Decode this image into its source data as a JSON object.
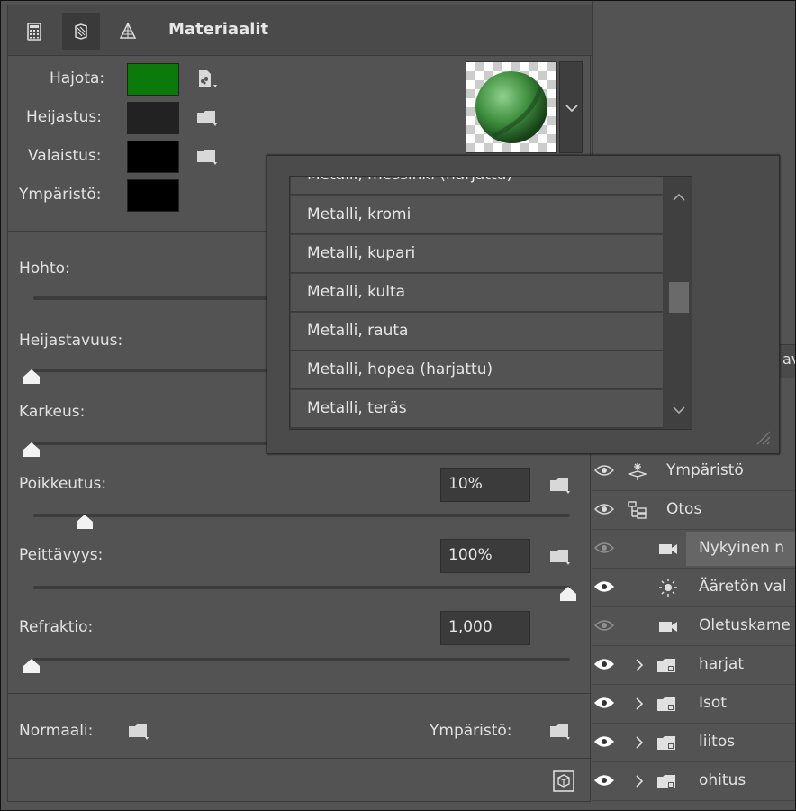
{
  "panel": {
    "title": "Materiaalit",
    "tabs": [
      "calculator-icon",
      "material-icon",
      "mesh-icon"
    ]
  },
  "material": {
    "diffuse_label": "Hajota:",
    "diffuse_color": "#0b7a0b",
    "specular_label": "Heijastus:",
    "specular_color": "#222222",
    "illumination_label": "Valaistus:",
    "illumination_color": "#000000",
    "environment_label": "Ympäristö:",
    "environment_color": "#000000"
  },
  "sliders": {
    "shine_label": "Hohto:",
    "reflectivity_label": "Heijastavuus:",
    "roughness_label": "Karkeus:",
    "bump_label": "Poikkeutus:",
    "bump_value": "10%",
    "opacity_label": "Peittävyys:",
    "opacity_value": "100%",
    "refraction_label": "Refraktio:",
    "refraction_value": "1,000"
  },
  "footer": {
    "normal_label": "Normaali:",
    "environment_label": "Ympäristö:"
  },
  "dropdown": {
    "items": [
      "Metalli, messinki (harjattu)",
      "Metalli, kromi",
      "Metalli, kupari",
      "Metalli, kulta",
      "Metalli, rauta",
      "Metalli, hopea (harjattu)",
      "Metalli, teräs"
    ]
  },
  "layers": {
    "partial_label": "av",
    "items": [
      {
        "label": "Ympäristö"
      },
      {
        "label": "Otos"
      },
      {
        "label": "Nykyinen n"
      },
      {
        "label": "Ääretön val"
      },
      {
        "label": "Oletuskame"
      },
      {
        "label": "harjat"
      },
      {
        "label": "Isot"
      },
      {
        "label": "liitos"
      },
      {
        "label": "ohitus"
      }
    ]
  }
}
